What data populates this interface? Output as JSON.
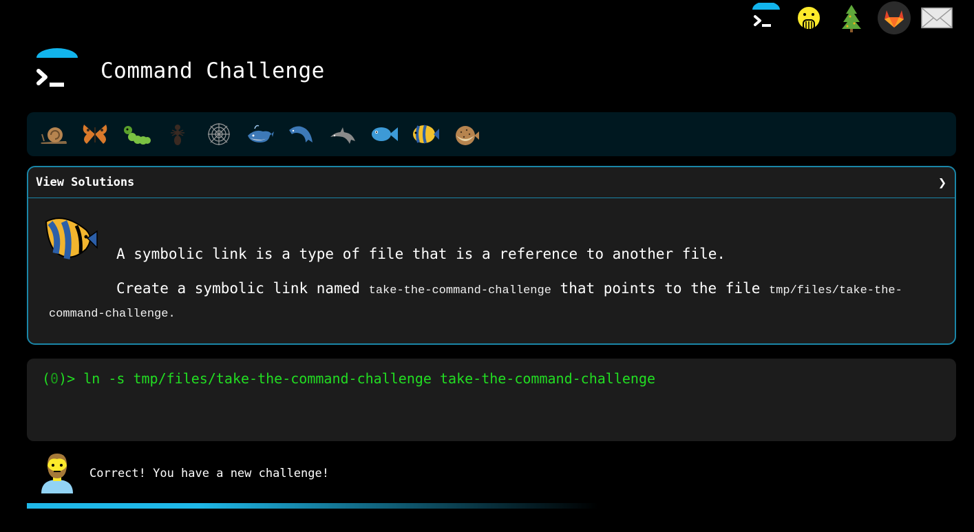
{
  "header": {
    "title": "Command Challenge"
  },
  "top_icons": [
    "terminal-logo-icon",
    "face-hand-over-mouth-icon",
    "evergreen-tree-icon",
    "gitlab-icon",
    "envelope-icon"
  ],
  "animals": [
    "snail",
    "butterfly",
    "caterpillar",
    "ant",
    "spider-web",
    "whale",
    "dolphin",
    "dolphin",
    "fish",
    "tropical-fish",
    "blowfish"
  ],
  "challenge": {
    "toggle_label": "View Solutions",
    "toggle_icon": "❯",
    "intro": "A symbolic link is a type of file that is a reference to another file.",
    "task_prefix": "Create a symbolic link named ",
    "task_name": "take-the-command-challenge",
    "task_middle": " that points to the file ",
    "task_target": "tmp/files/take-the-command-challenge",
    "task_suffix": "."
  },
  "terminal": {
    "prompt_open": "(",
    "prompt_code": "0",
    "prompt_close": ")> ",
    "command": "ln -s tmp/files/take-the-command-challenge take-the-command-challenge"
  },
  "status": {
    "message": "Correct! You have a new challenge!"
  },
  "colors": {
    "accent": "#1a86a8",
    "terminal_text": "#22dd22",
    "progress": "#1fb8e8"
  }
}
